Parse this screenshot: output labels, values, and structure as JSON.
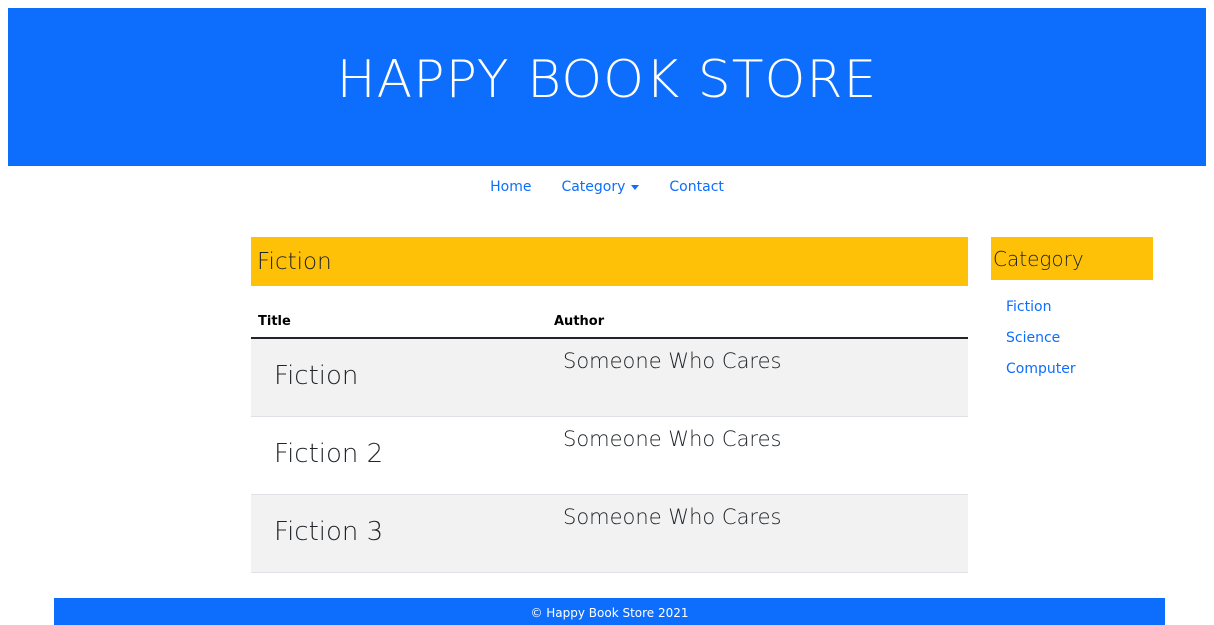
{
  "banner": {
    "title": "HAPPY BOOK STORE"
  },
  "nav": {
    "items": [
      {
        "label": "Home"
      },
      {
        "label": "Category",
        "has_dropdown": true
      },
      {
        "label": "Contact"
      }
    ]
  },
  "main": {
    "heading": "Fiction",
    "table": {
      "columns": [
        "Title",
        "Author"
      ],
      "rows": [
        {
          "title": "Fiction",
          "author": "Someone Who Cares"
        },
        {
          "title": "Fiction 2",
          "author": "Someone Who Cares"
        },
        {
          "title": "Fiction 3",
          "author": "Someone Who Cares"
        }
      ]
    }
  },
  "sidebar": {
    "heading": "Category",
    "items": [
      {
        "label": "Fiction"
      },
      {
        "label": "Science"
      },
      {
        "label": "Computer"
      }
    ]
  },
  "footer": {
    "text": "© Happy Book Store 2021"
  },
  "colors": {
    "primary": "#0d6efd",
    "accent": "#ffc107",
    "stripe": "#f2f2f2"
  }
}
